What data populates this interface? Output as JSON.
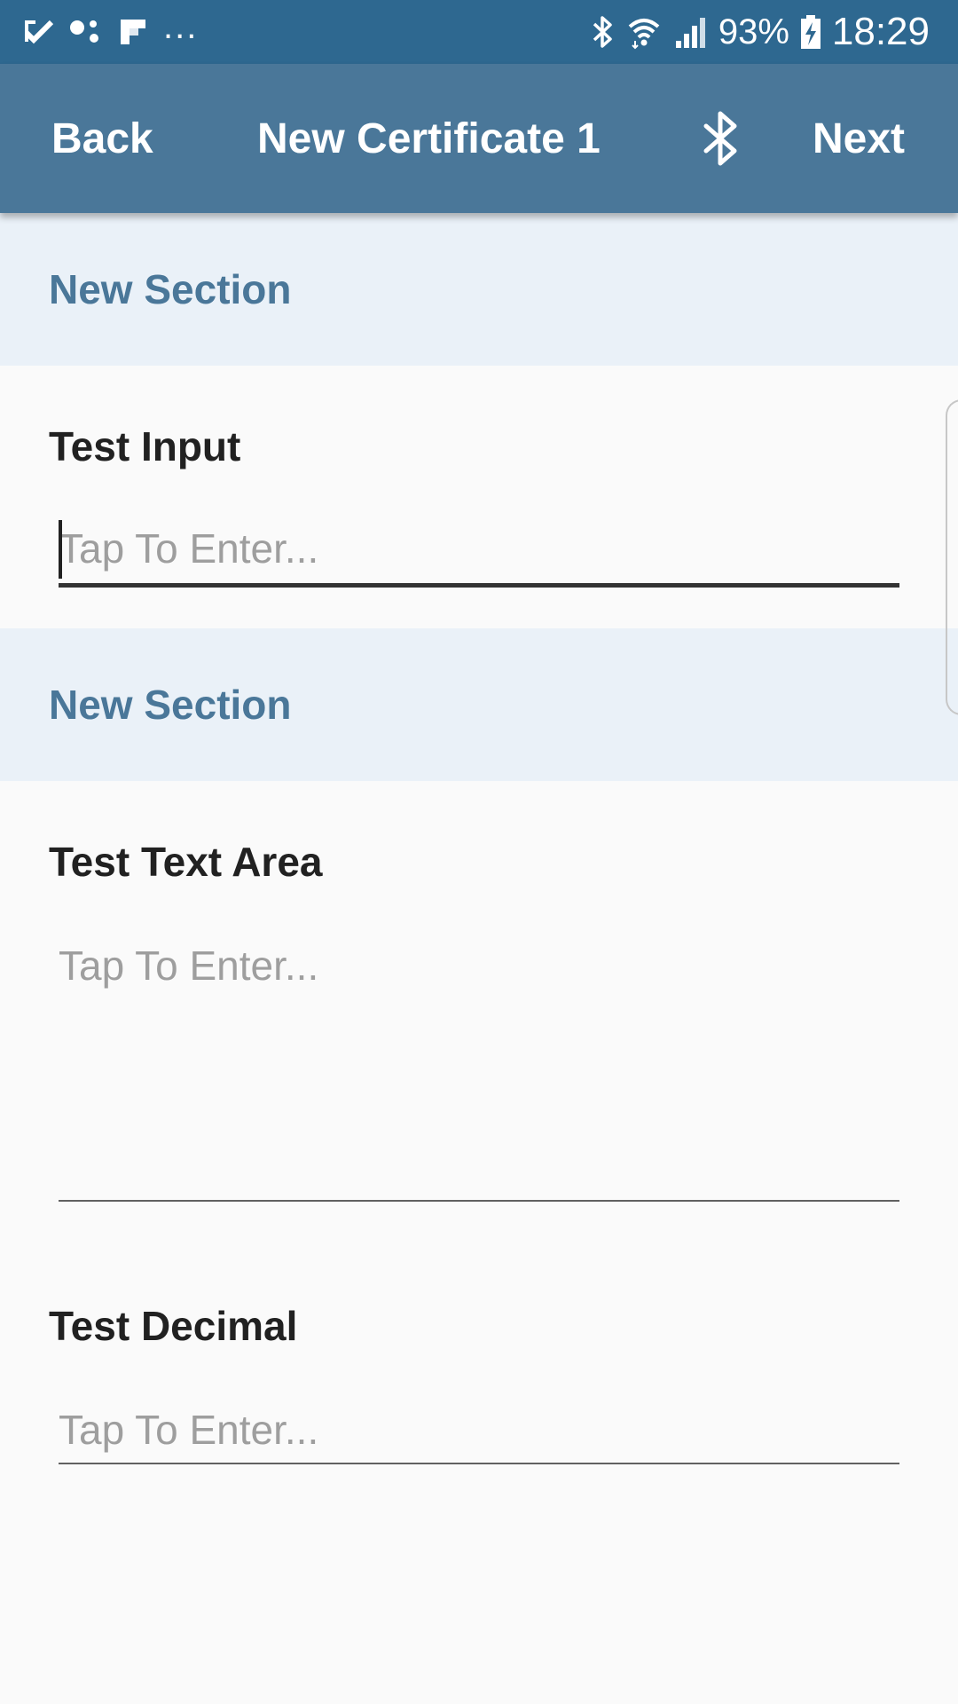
{
  "status_bar": {
    "left_icons": [
      "check-notification-icon",
      "dots-notification-icon",
      "flipboard-icon"
    ],
    "more": "...",
    "battery": "93%",
    "time": "18:29",
    "right_icons": [
      "bluetooth-icon",
      "wifi-icon",
      "signal-icon",
      "battery-charging-icon"
    ]
  },
  "app_bar": {
    "back_label": "Back",
    "title": "New Certificate 1",
    "bluetooth_icon": "bluetooth-icon",
    "next_label": "Next"
  },
  "sections": [
    {
      "title": "New Section",
      "fields": [
        {
          "label": "Test Input",
          "placeholder": "Tap To Enter...",
          "value": ""
        }
      ]
    },
    {
      "title": "New Section",
      "fields": [
        {
          "label": "Test Text Area",
          "placeholder": "Tap To Enter...",
          "value": ""
        },
        {
          "label": "Test Decimal",
          "placeholder": "Tap To Enter...",
          "value": ""
        }
      ]
    }
  ],
  "colors": {
    "status_bar": "#2e6890",
    "app_bar": "#4a7799",
    "section_header_bg": "#eaf1f8",
    "section_title": "#4a7799",
    "page_bg": "#fafafa"
  }
}
